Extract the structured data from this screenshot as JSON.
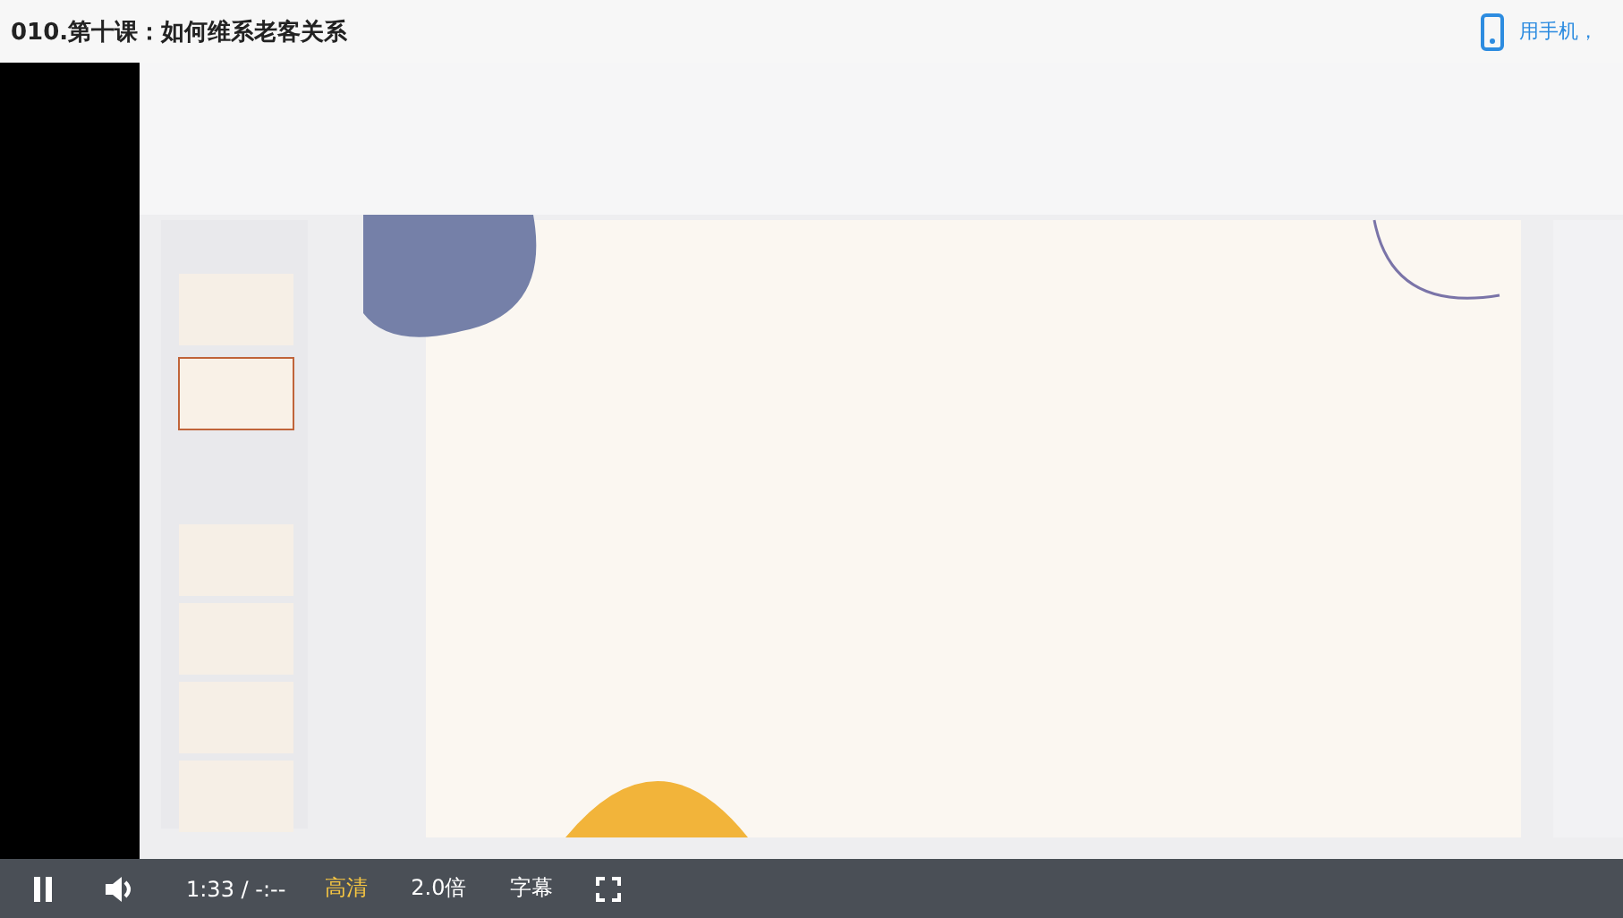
{
  "page": {
    "title": "010.第十课：如何维系老客关系",
    "mobile_link": "用手机，"
  },
  "player": {
    "playing": true,
    "time": "1:33 / -:--",
    "quality": "高清",
    "speed": "2.0倍",
    "subtitles": "字幕"
  }
}
